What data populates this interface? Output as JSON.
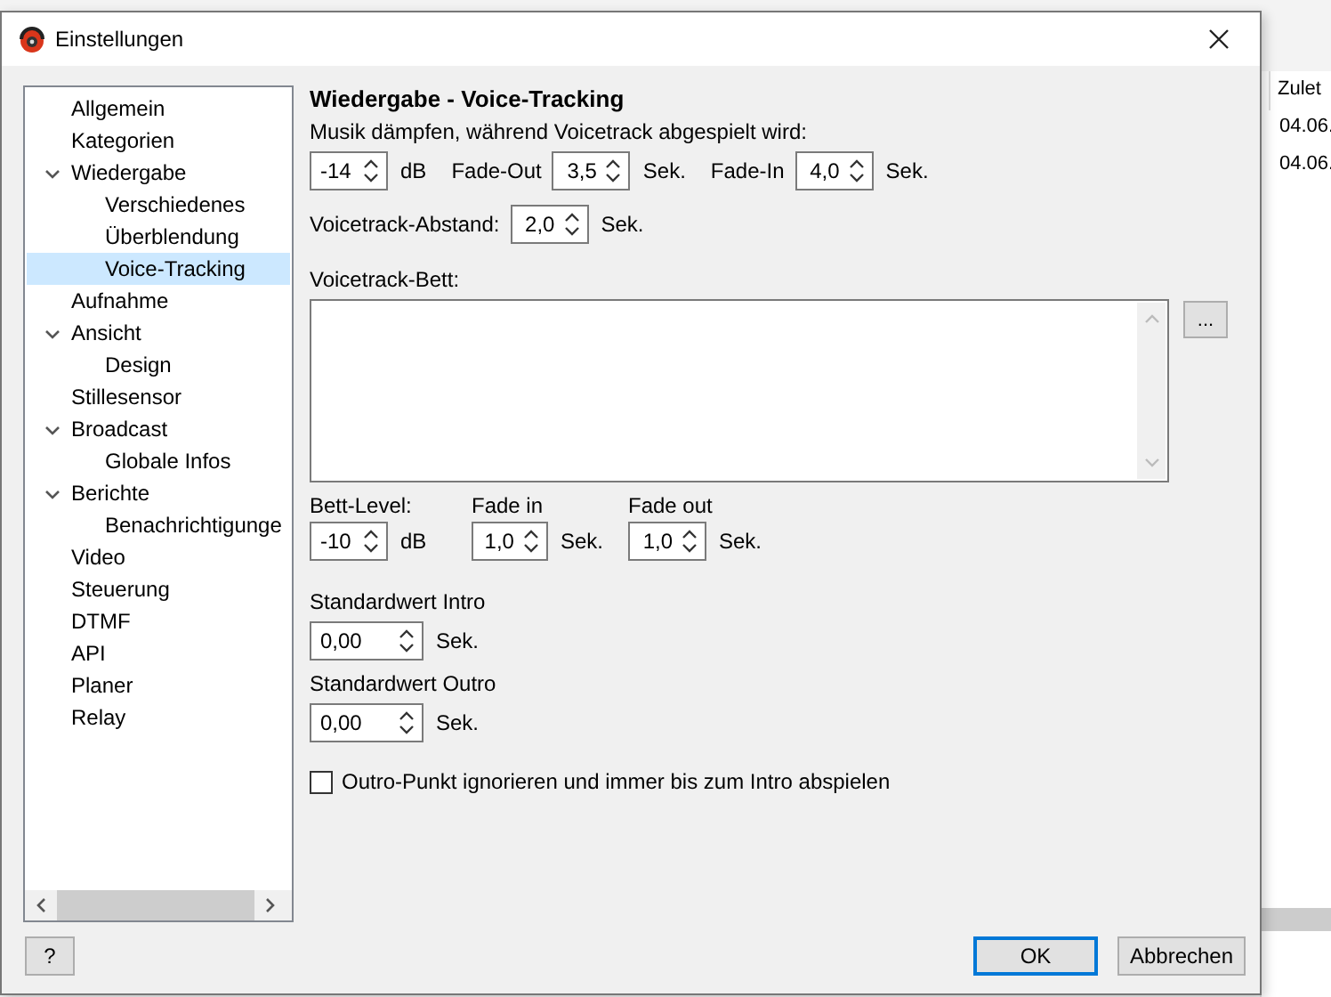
{
  "background_app": {
    "column_header": "Zulet",
    "dates": [
      "04.06.",
      "04.06."
    ]
  },
  "window": {
    "title": "Einstellungen"
  },
  "tree": {
    "items": [
      {
        "label": "Allgemein",
        "selected": false
      },
      {
        "label": "Kategorien",
        "selected": false
      },
      {
        "label": "Wiedergabe",
        "selected": false,
        "expanded": true,
        "children": [
          {
            "label": "Verschiedenes",
            "selected": false
          },
          {
            "label": "Überblendung",
            "selected": false
          },
          {
            "label": "Voice-Tracking",
            "selected": true
          }
        ]
      },
      {
        "label": "Aufnahme",
        "selected": false
      },
      {
        "label": "Ansicht",
        "selected": false,
        "expanded": true,
        "children": [
          {
            "label": "Design",
            "selected": false
          }
        ]
      },
      {
        "label": "Stillesensor",
        "selected": false
      },
      {
        "label": "Broadcast",
        "selected": false,
        "expanded": true,
        "children": [
          {
            "label": "Globale Infos",
            "selected": false
          }
        ]
      },
      {
        "label": "Berichte",
        "selected": false,
        "expanded": true,
        "children": [
          {
            "label": "Benachrichtigunge",
            "selected": false
          }
        ]
      },
      {
        "label": "Video",
        "selected": false
      },
      {
        "label": "Steuerung",
        "selected": false
      },
      {
        "label": "DTMF",
        "selected": false
      },
      {
        "label": "API",
        "selected": false
      },
      {
        "label": "Planer",
        "selected": false
      },
      {
        "label": "Relay",
        "selected": false
      }
    ]
  },
  "section_title": "Wiedergabe - Voice-Tracking",
  "ducking": {
    "label": "Musik dämpfen, während Voicetrack abgespielt wird:",
    "fields": [
      {
        "value": "-14",
        "unit": "dB"
      },
      {
        "label": "Fade-Out",
        "value": "3,5",
        "unit": "Sek."
      },
      {
        "label": "Fade-In",
        "value": "4,0",
        "unit": "Sek."
      }
    ]
  },
  "gap": {
    "label": "Voicetrack-Abstand:",
    "value": "2,0",
    "unit": "Sek."
  },
  "bed": {
    "label": "Voicetrack-Bett:",
    "browse_button": "..."
  },
  "bed_controls": [
    {
      "label": "Bett-Level:",
      "value": "-10",
      "unit": "dB"
    },
    {
      "label": "Fade in",
      "value": "1,0",
      "unit": "Sek."
    },
    {
      "label": "Fade out",
      "value": "1,0",
      "unit": "Sek."
    }
  ],
  "defaults": [
    {
      "label": "Standardwert Intro",
      "value": "0,00",
      "unit": "Sek."
    },
    {
      "label": "Standardwert Outro",
      "value": "0,00",
      "unit": "Sek."
    }
  ],
  "ignore_outro": {
    "label": "Outro-Punkt ignorieren und immer bis zum Intro abspielen",
    "checked": false
  },
  "buttons": {
    "help": "?",
    "ok": "OK",
    "cancel": "Abbrechen"
  }
}
